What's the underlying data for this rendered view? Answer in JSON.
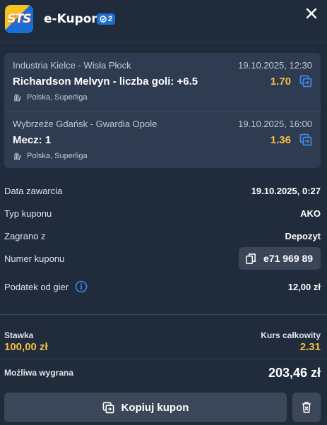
{
  "header": {
    "title": "e-Kupon",
    "bet_count": "2",
    "logo_text": "STS"
  },
  "slips": [
    {
      "match": "Industria Kielce - Wisła Płock",
      "date": "19.10.2025, 12:30",
      "pick": "Richardson Melvyn - liczba goli: +6.5",
      "odds": "1.70",
      "league": "Polska, Superliga"
    },
    {
      "match": "Wybrzeże Gdańsk - Gwardia Opole",
      "date": "19.10.2025, 16:00",
      "pick": "Mecz: 1",
      "odds": "1.36",
      "league": "Polska, Superliga"
    }
  ],
  "details": {
    "date_label": "Data zawarcia",
    "date_value": "19.10.2025, 0:27",
    "type_label": "Typ kuponu",
    "type_value": "AKO",
    "played_label": "Zagrano z",
    "played_value": "Depozyt",
    "number_label": "Numer kuponu",
    "number_value": "e71 969 89",
    "tax_label": "Podatek od gier",
    "tax_value": "12,00 zł"
  },
  "summary": {
    "stake_label": "Stawka",
    "stake_value": "100,00 zł",
    "total_odds_label": "Kurs całkowity",
    "total_odds_value": "2.31",
    "win_label": "Możliwa wygrana",
    "win_value": "203,46 zł"
  },
  "actions": {
    "copy_label": "Kopiuj kupon"
  },
  "colors": {
    "background": "#202b3b",
    "card": "#2e3b50",
    "accent_odds": "#f5bf42",
    "badge": "#1f6fd1",
    "button": "#3c4759"
  },
  "icons": [
    "close-icon",
    "copy-icon",
    "handball-icon",
    "info-icon",
    "trash-icon"
  ]
}
